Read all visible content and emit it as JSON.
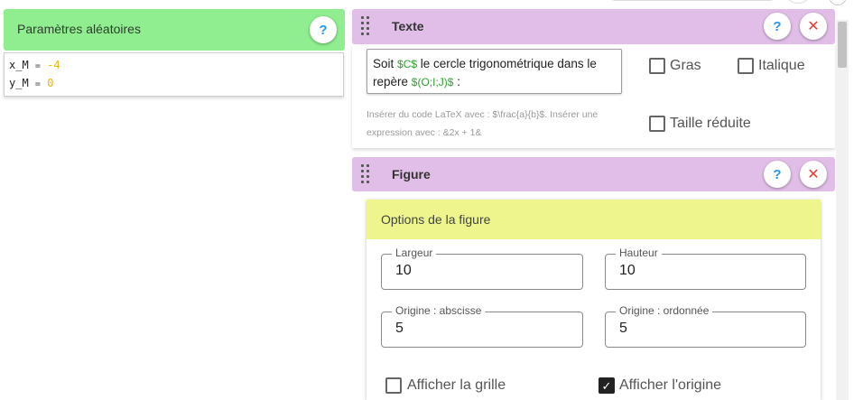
{
  "params": {
    "title": "Paramètres aléatoires",
    "help": "?",
    "lines": [
      {
        "name": "x_M",
        "eq": "=",
        "value": "-4"
      },
      {
        "name": "y_M",
        "eq": "=",
        "value": "0"
      }
    ]
  },
  "texte": {
    "title": "Texte",
    "help": "?",
    "close": "✕",
    "content_parts": [
      "Soit ",
      "$C$",
      " le cercle trigonométrique dans le repère ",
      "$(O;I;J)$",
      " :"
    ],
    "hint": "Insérer du code LaTeX avec : $\\frac{a}{b}$. Insérer une expression avec : &2x + 1&",
    "options": {
      "bold": "Gras",
      "italic": "Italique",
      "small": "Taille réduite"
    }
  },
  "figure": {
    "title": "Figure",
    "help": "?",
    "close": "✕",
    "options_title": "Options de la figure",
    "fields": {
      "largeur": {
        "label": "Largeur",
        "value": "10"
      },
      "hauteur": {
        "label": "Hauteur",
        "value": "10"
      },
      "origine_abscisse": {
        "label": "Origine : abscisse",
        "value": "5"
      },
      "origine_ordonnee": {
        "label": "Origine : ordonnée",
        "value": "5"
      }
    },
    "checkboxes": {
      "grille": {
        "label": "Afficher la grille",
        "checked": false
      },
      "origine": {
        "label": "Afficher l'origine",
        "checked": true
      }
    }
  },
  "colors": {
    "params_header": "#90ee90",
    "block_header": "#e1bee7",
    "options_header": "#eef58c",
    "help_icon": "#2196f3",
    "close_icon": "#e53935",
    "latex_green": "#2e9e2e",
    "param_value": "#f0b400"
  }
}
